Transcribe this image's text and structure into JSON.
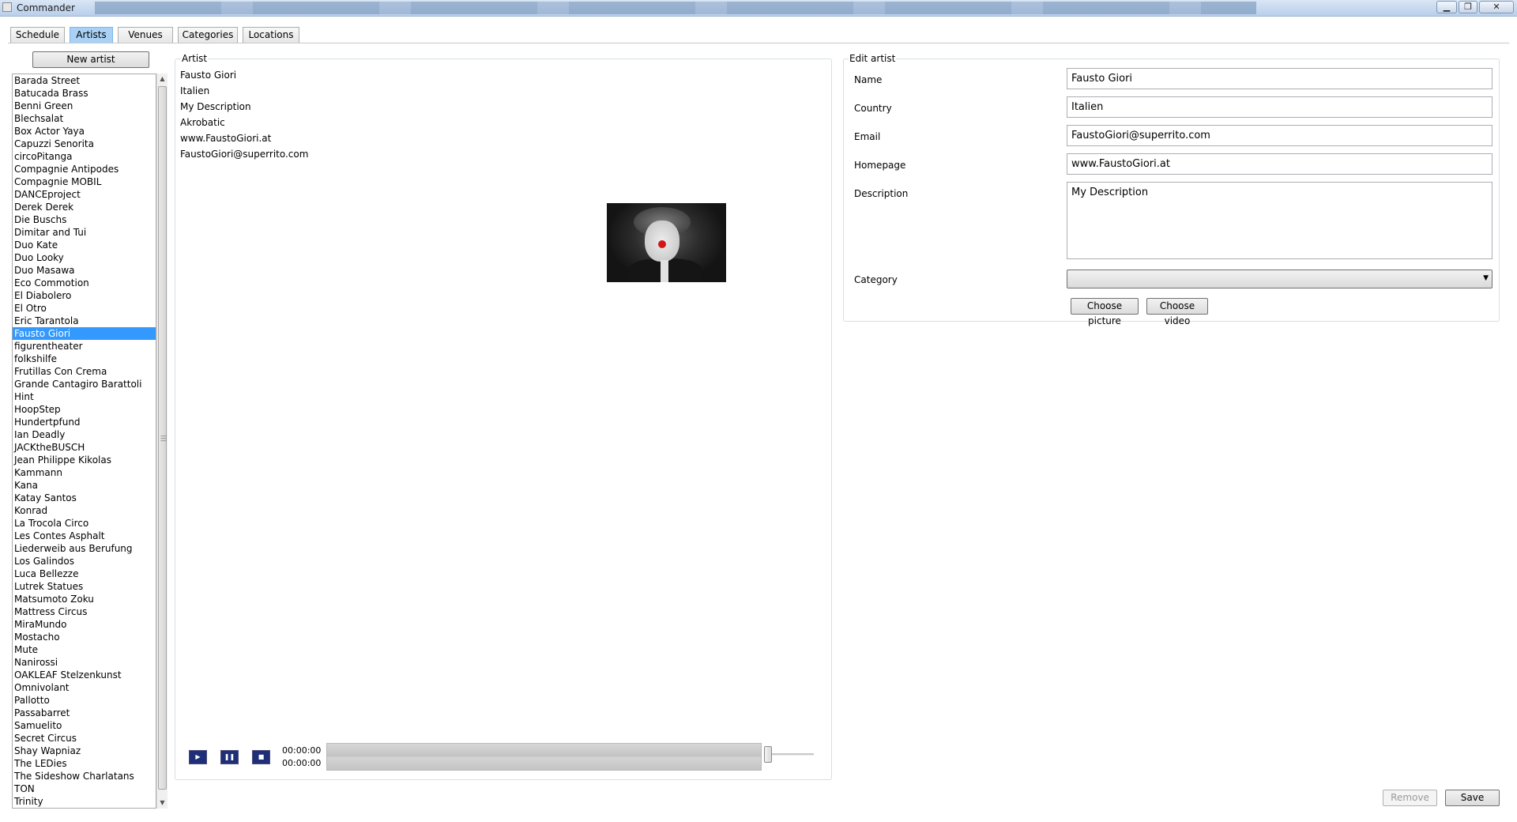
{
  "window": {
    "title": "Commander"
  },
  "tabs": [
    {
      "label": "Schedule"
    },
    {
      "label": "Artists",
      "selected": true
    },
    {
      "label": "Venues"
    },
    {
      "label": "Categories"
    },
    {
      "label": "Locations"
    }
  ],
  "artist_list": {
    "new_artist_label": "New artist",
    "selected": "Fausto Giori",
    "items": [
      "Barada Street",
      "Batucada Brass",
      "Benni Green",
      "Blechsalat",
      "Box Actor Yaya",
      "Capuzzi Senorita",
      "circoPitanga",
      "Compagnie Antipodes",
      "Compagnie MOBIL",
      "DANCEproject",
      "Derek Derek",
      "Die Buschs",
      "Dimitar and Tui",
      "Duo Kate",
      "Duo Looky",
      "Duo Masawa",
      "Eco Commotion",
      "El Diabolero",
      "El Otro",
      "Eric Tarantola",
      "Fausto Giori",
      "figurentheater",
      "folkshilfe",
      "Frutillas Con Crema",
      "Grande Cantagiro Barattoli",
      "Hint",
      "HoopStep",
      "Hundertpfund",
      "Ian Deadly",
      "JACKtheBUSCH",
      "Jean Philippe Kikolas",
      "Kammann",
      "Kana",
      "Katay Santos",
      "Konrad",
      "La Trocola Circo",
      "Les Contes Asphalt",
      "Liederweib aus Berufung",
      "Los Galindos",
      "Luca Bellezze",
      "Lutrek Statues",
      "Matsumoto Zoku",
      "Mattress Circus",
      "MiraMundo",
      "Mostacho",
      "Mute",
      "Nanirossi",
      "OAKLEAF Stelzenkunst",
      "Omnivolant",
      "Pallotto",
      "Passabarret",
      "Samuelito",
      "Secret Circus",
      "Shay Wapniaz",
      "The LEDies",
      "The Sideshow Charlatans",
      "TON",
      "Trinity"
    ]
  },
  "artist_panel": {
    "header": "Artist",
    "name": "Fausto Giori",
    "country": "Italien",
    "description": "My Description",
    "category": "Akrobatic",
    "homepage": "www.FaustoGiori.at",
    "email": "FaustoGiori@superrito.com",
    "photo": "clown-portrait"
  },
  "media": {
    "time_current": "00:00:00",
    "time_total": "00:00:00"
  },
  "edit_panel": {
    "header": "Edit artist",
    "labels": {
      "name": "Name",
      "country": "Country",
      "email": "Email",
      "homepage": "Homepage",
      "description": "Description",
      "category": "Category"
    },
    "values": {
      "name": "Fausto Giori",
      "country": "Italien",
      "email": "FaustoGiori@superrito.com",
      "homepage": "www.FaustoGiori.at",
      "description": "My Description",
      "category": ""
    },
    "choose_picture_label": "Choose picture",
    "choose_video_label": "Choose video"
  },
  "actions": {
    "remove_label": "Remove",
    "save_label": "Save"
  }
}
